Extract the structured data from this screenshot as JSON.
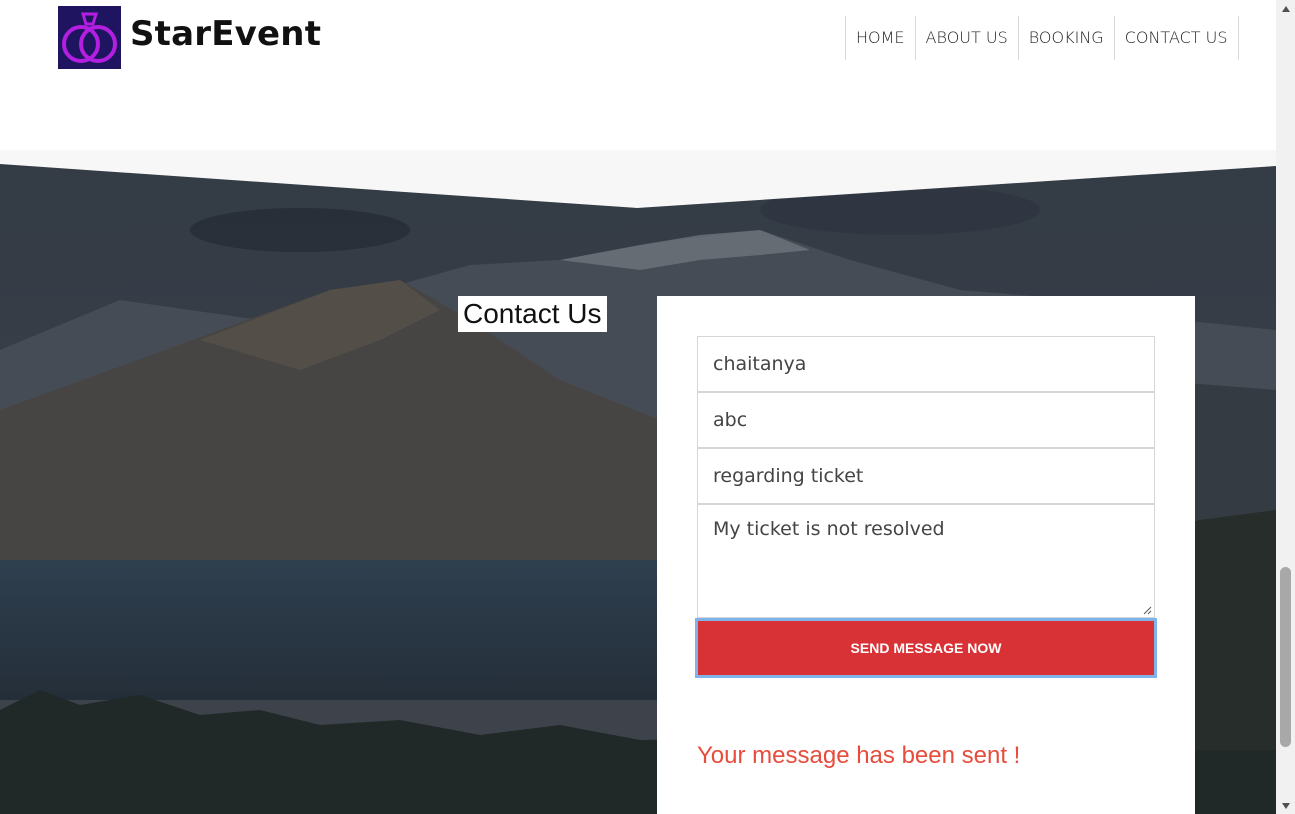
{
  "brand": {
    "name": "StarEvent",
    "logo": "double-ring-icon"
  },
  "nav": {
    "items": [
      {
        "label": "HOME"
      },
      {
        "label": "ABOUT US"
      },
      {
        "label": "BOOKING"
      },
      {
        "label": "CONTACT US"
      }
    ]
  },
  "contact": {
    "title": "Contact Us",
    "fields": {
      "name": "chaitanya",
      "email": "abc",
      "subject": "regarding ticket",
      "message": "My ticket is not resolved"
    },
    "send_label": "SEND MESSAGE NOW",
    "success_message": "Your message has been sent !"
  },
  "colors": {
    "accent": "#d93236",
    "success_text": "#e74c3c",
    "logo_bg": "#1f1460",
    "logo_ring": "#b31fe0"
  },
  "icons": {
    "scroll_up": "triangle-up-icon",
    "scroll_down": "triangle-down-icon",
    "resize": "resize-grip-icon"
  }
}
